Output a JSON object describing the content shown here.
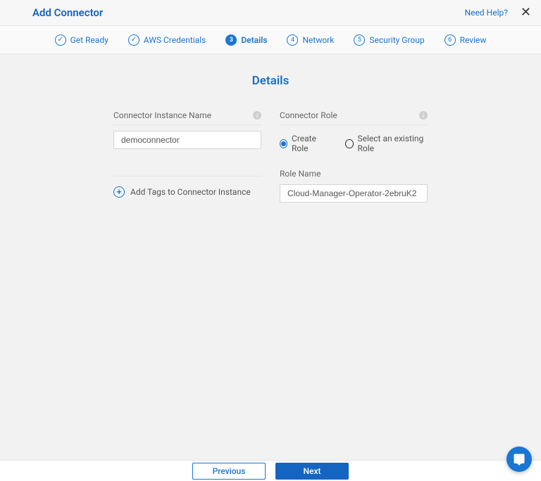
{
  "header": {
    "title": "Add Connector",
    "help": "Need Help?"
  },
  "stepper": [
    {
      "label": "Get Ready",
      "state": "done"
    },
    {
      "label": "AWS Credentials",
      "state": "done"
    },
    {
      "label": "Details",
      "state": "active",
      "num": "3"
    },
    {
      "label": "Network",
      "state": "todo",
      "num": "4"
    },
    {
      "label": "Security Group",
      "state": "todo",
      "num": "5"
    },
    {
      "label": "Review",
      "state": "todo",
      "num": "6"
    }
  ],
  "page": {
    "title": "Details"
  },
  "form": {
    "instance_name_label": "Connector Instance Name",
    "instance_name_value": "democonnector",
    "add_tags_label": "Add Tags to Connector Instance",
    "role_label": "Connector Role",
    "role_option_create": "Create Role",
    "role_option_existing": "Select an existing Role",
    "role_selected": "create",
    "role_name_label": "Role Name",
    "role_name_value": "Cloud-Manager-Operator-2ebruK2"
  },
  "footer": {
    "previous": "Previous",
    "next": "Next"
  }
}
